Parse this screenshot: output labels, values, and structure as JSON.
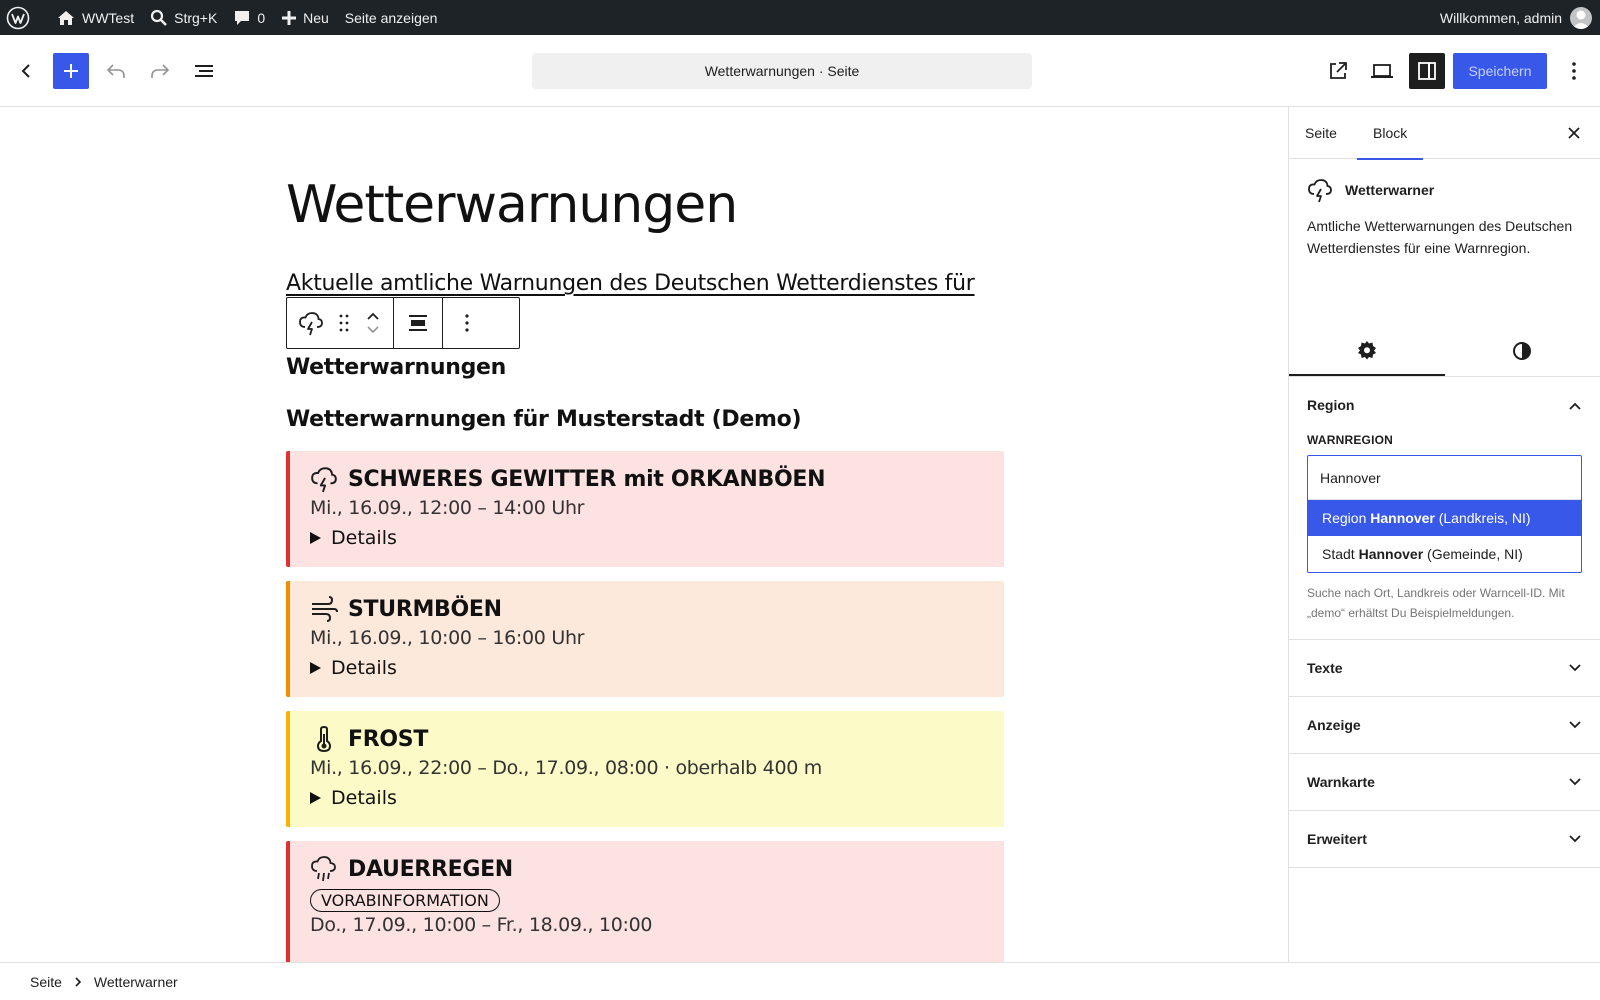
{
  "adminbar": {
    "site_name": "WWTest",
    "search_label": "Strg+K",
    "comments_count": "0",
    "new_label": "Neu",
    "view_label": "Seite anzeigen",
    "welcome": "Willkommen, admin"
  },
  "header": {
    "document_title": "Wetterwarnungen · Seite",
    "save_label": "Speichern"
  },
  "content": {
    "page_title": "Wetterwarnungen",
    "intro_text": "Aktuelle amtliche Warnungen des Deutschen Wetterdienstes für",
    "block_heading": "Wetterwarnungen",
    "sub_heading": "Wetterwarnungen für Musterstadt (Demo)",
    "warnings": [
      {
        "title": "SCHWERES GEWITTER mit ORKANBÖEN",
        "time": "Mi., 16.09., 12:00 – 14:00 Uhr",
        "details": "Details",
        "icon": "thunderstorm-icon",
        "color": "#e03131",
        "bg": "#fde2e2"
      },
      {
        "title": "STURMBÖEN",
        "time": "Mi., 16.09., 10:00 – 16:00 Uhr",
        "details": "Details",
        "icon": "wind-icon",
        "color": "#f08c00",
        "bg": "#fde8dc"
      },
      {
        "title": "FROST",
        "time": "Mi., 16.09., 22:00 – Do., 17.09., 08:00 · oberhalb 400 m",
        "details": "Details",
        "icon": "thermometer-icon",
        "color": "#fab005",
        "bg": "#fcfbc7"
      },
      {
        "title": "DAUERREGEN",
        "badge": "VORABINFORMATION",
        "time": "Do., 17.09., 10:00 – Fr., 18.09., 10:00",
        "icon": "rain-icon",
        "color": "#e03131",
        "bg": "#fde2e2"
      }
    ]
  },
  "sidebar": {
    "tabs": [
      "Seite",
      "Block"
    ],
    "block_name": "Wetterwarner",
    "block_description": "Amtliche Wetterwarnungen des Deutschen Wetterdienstes für eine Warnregion.",
    "panels": {
      "region": {
        "title": "Region",
        "field_label": "Warnregion",
        "input_value": "Hannover",
        "options": [
          {
            "prefix": "Region ",
            "match": "Hannover",
            "suffix": " (Landkreis, NI)"
          },
          {
            "prefix": "Stadt ",
            "match": "Hannover",
            "suffix": " (Gemeinde, NI)"
          }
        ],
        "help": "Suche nach Ort, Landkreis oder Warncell-ID. Mit „demo“ erhältst Du Beispielmeldungen."
      },
      "collapsed": [
        "Texte",
        "Anzeige",
        "Warnkarte",
        "Erweitert"
      ]
    }
  },
  "footer": {
    "breadcrumb": [
      "Seite",
      "Wetterwarner"
    ]
  },
  "colors": {
    "accent": "#3858e9",
    "adminbar": "#1d2327"
  }
}
